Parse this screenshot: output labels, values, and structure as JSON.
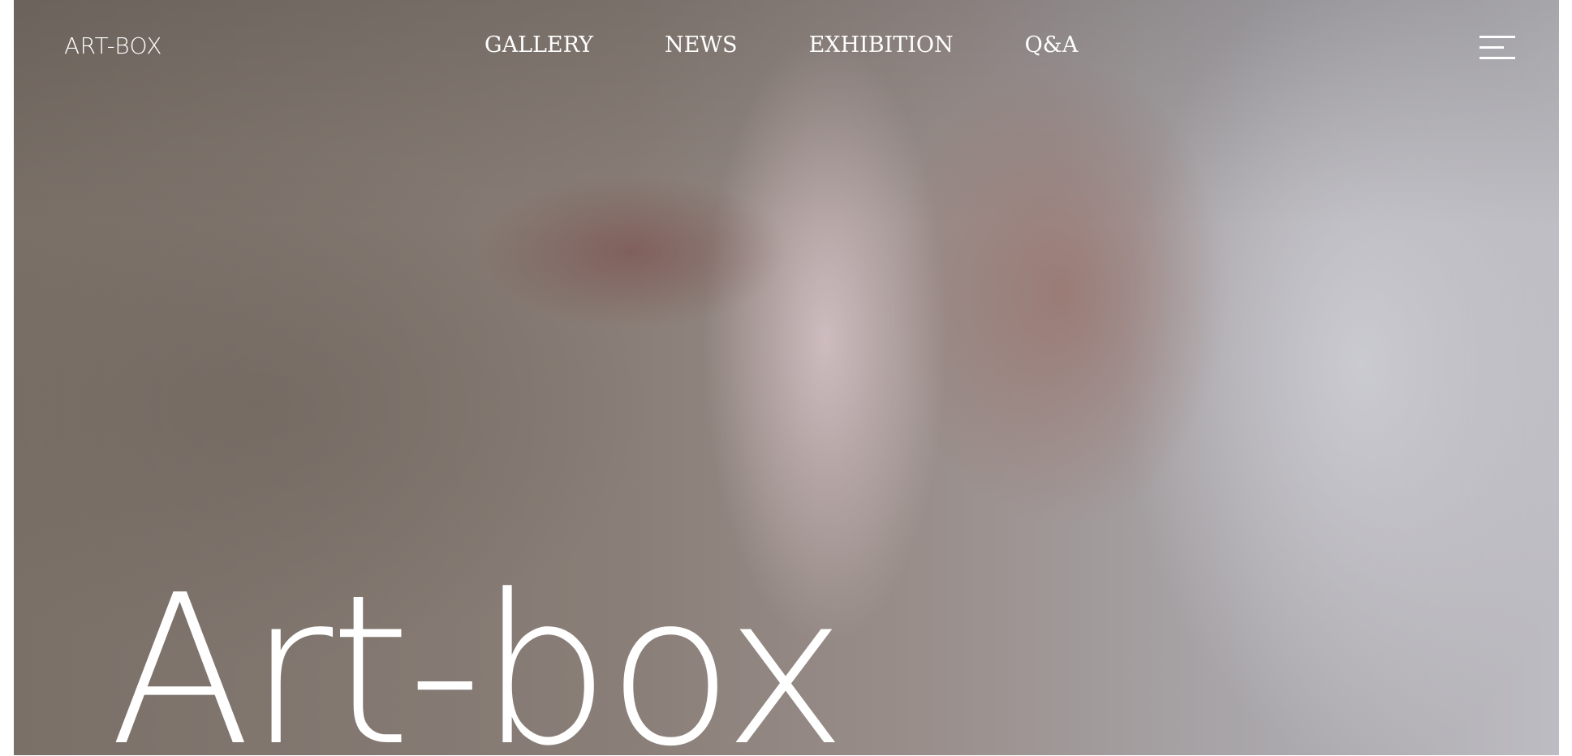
{
  "header": {
    "logo": "ART-BOX",
    "nav": [
      {
        "label": "GALLERY"
      },
      {
        "label": "NEWS"
      },
      {
        "label": "EXHIBITION"
      },
      {
        "label": "Q&A"
      }
    ],
    "menu_icon": "hamburger-menu-icon"
  },
  "hero": {
    "title": "Art-box",
    "background": "blurred photo of hands"
  },
  "colors": {
    "text": "#ffffff",
    "page_background": "#ffffff"
  }
}
